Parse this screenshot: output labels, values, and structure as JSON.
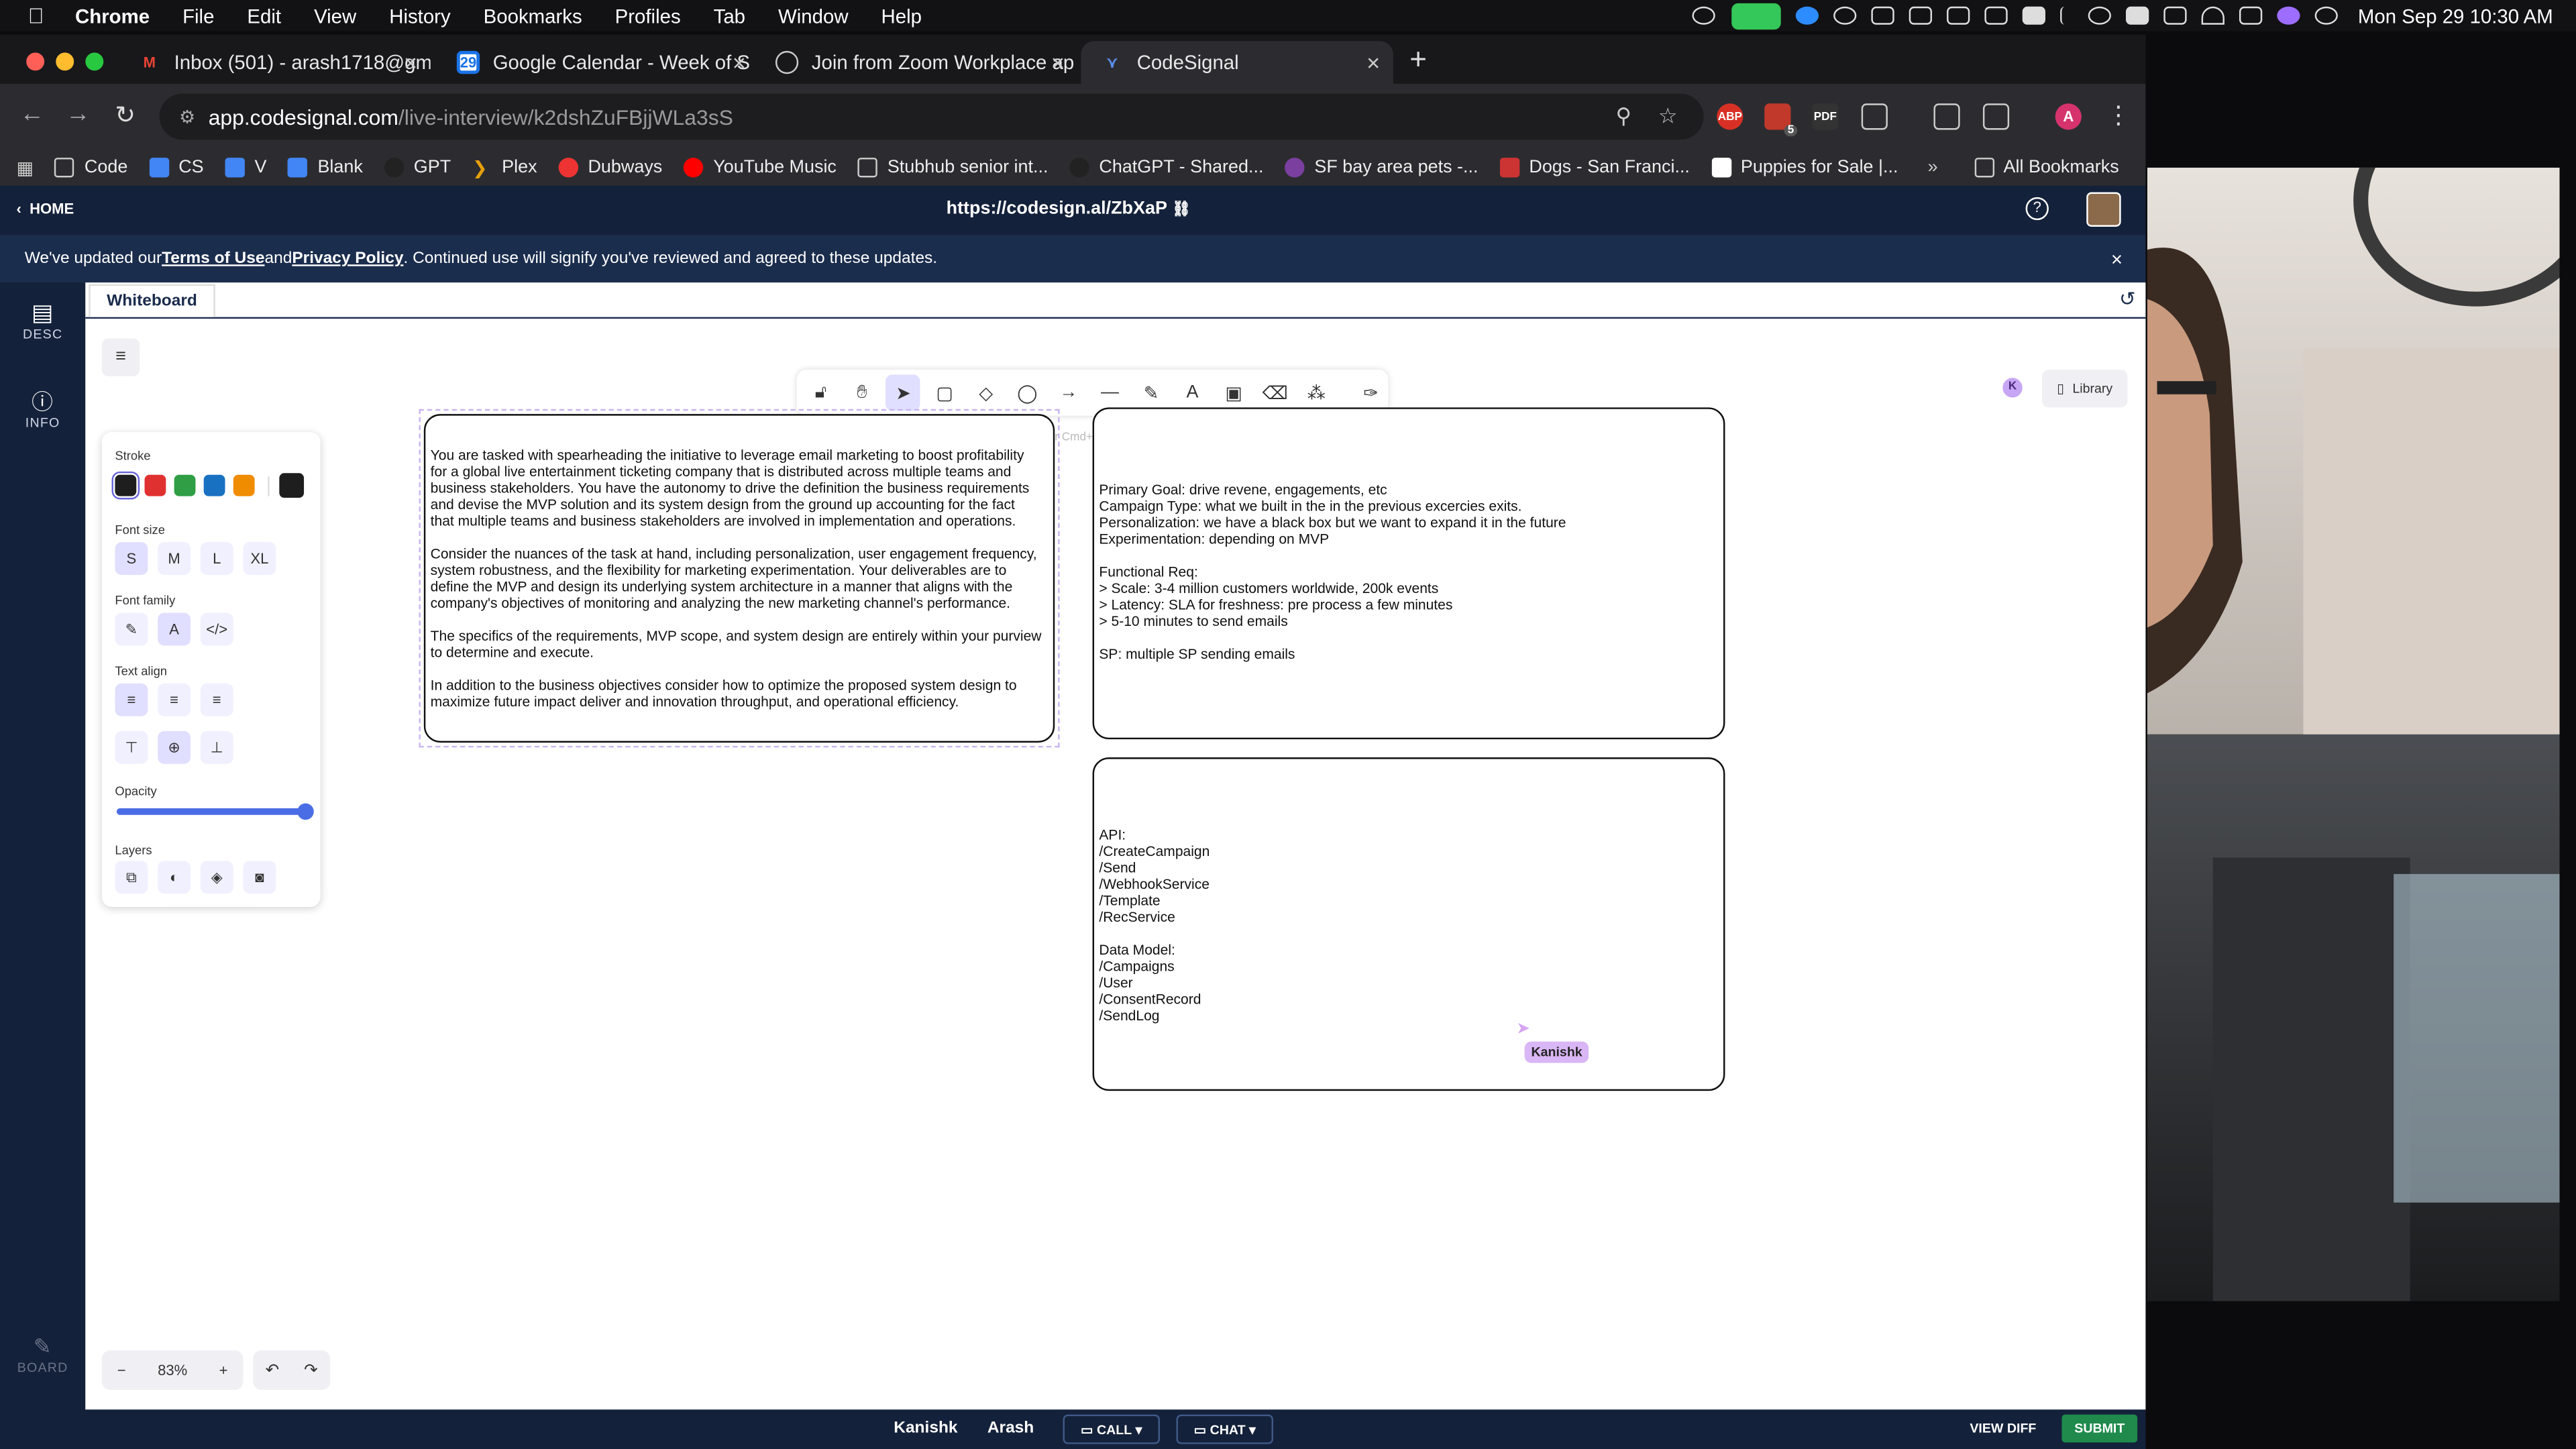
{
  "menubar": {
    "app": "Chrome",
    "items": [
      "File",
      "Edit",
      "View",
      "History",
      "Bookmarks",
      "Profiles",
      "Tab",
      "Window",
      "Help"
    ],
    "clock": "Mon Sep 29  10:30 AM"
  },
  "tabs": [
    {
      "title": "Inbox (501) - arash1718@gm",
      "icon": "gmail-icon"
    },
    {
      "title": "Google Calendar - Week of S",
      "icon": "calendar-icon"
    },
    {
      "title": "Join from Zoom Workplace ap",
      "icon": "zoom-icon"
    },
    {
      "title": "CodeSignal",
      "icon": "codesignal-icon"
    }
  ],
  "address": {
    "host": "app.codesignal.com",
    "path": "/live-interview/k2dshZuFBjjWLa3sS"
  },
  "extension_badge": "5",
  "profile_initial": "A",
  "bookmarks": [
    "Code",
    "CS",
    "V",
    "Blank",
    "GPT",
    "Plex",
    "Dubways",
    "YouTube Music",
    "Stubhub senior int...",
    "ChatGPT - Shared...",
    "SF bay area pets -...",
    "Dogs - San Franci...",
    "Puppies for Sale |..."
  ],
  "all_bookmarks": "All Bookmarks",
  "header": {
    "home": "HOME",
    "link": "https://codesign.al/ZbXaP"
  },
  "banner": {
    "pre": "We've updated our ",
    "terms": "Terms of Use",
    "and": " and ",
    "privacy": "Privacy Policy",
    "post": ". Continued use will signify you've reviewed and agreed to these updates."
  },
  "rail": {
    "desc": "DESC",
    "info": "INFO",
    "board": "BOARD"
  },
  "whiteboard_tab": "Whiteboard",
  "hint": "Press Escape or Cmd+Enter to finish editing",
  "library": "Library",
  "collab_initial": "K",
  "panel": {
    "stroke": "Stroke",
    "font_size": "Font size",
    "sizes": [
      "S",
      "M",
      "L",
      "XL"
    ],
    "font_family": "Font family",
    "text_align": "Text align",
    "opacity": "Opacity",
    "opacity_value": 1.0,
    "layers": "Layers",
    "colors": [
      "#1e1e1e",
      "#e03131",
      "#2f9e44",
      "#1971c2",
      "#f08c00"
    ]
  },
  "cards": {
    "prompt": "You are tasked with spearheading the initiative to leverage email marketing to boost profitability\nfor a global live entertainment ticketing company that is distributed across multiple teams and\nbusiness stakeholders. You have the autonomy to drive the definition the business requirements\nand devise the MVP solution and its system design from the ground up accounting for the fact\nthat multiple teams and business stakeholders are involved in implementation and operations.\n\nConsider the nuances of the task at hand, including personalization, user engagement frequency,\nsystem robustness, and the flexibility for marketing experimentation. Your deliverables are to\ndefine the MVP and design its underlying system architecture in a manner that aligns with the\ncompany's objectives of monitoring and analyzing the new marketing channel's performance.\n\nThe specifics of the requirements, MVP scope, and system design are entirely within your purview\nto determine and execute.\n\nIn addition to the business objectives consider how to optimize the proposed system design to\nmaximize future impact deliver and innovation throughput, and operational efficiency.",
    "goals": "Primary Goal: drive revene, engagements, etc\nCampaign Type: what we built in the in the previous excercies exits.\nPersonalization: we have a black box but we want to expand it in the future\nExperimentation: depending on MVP\n\nFunctional Req:\n> Scale: 3-4 million customers worldwide, 200k events\n> Latency: SLA for freshness: pre process a few minutes\n> 5-10 minutes to send emails\n\nSP: multiple SP sending emails",
    "api": "API:\n/CreateCampaign\n/Send\n/WebhookService\n/Template\n/RecService\n\nData Model:\n/Campaigns\n/User\n/ConsentRecord\n/SendLog"
  },
  "cursor_label": "Kanishk",
  "zoom": "83%",
  "footer": {
    "p1": "Kanishk",
    "p2": "Arash",
    "call": "CALL",
    "chat": "CHAT",
    "view_diff": "VIEW DIFF",
    "submit": "SUBMIT"
  }
}
